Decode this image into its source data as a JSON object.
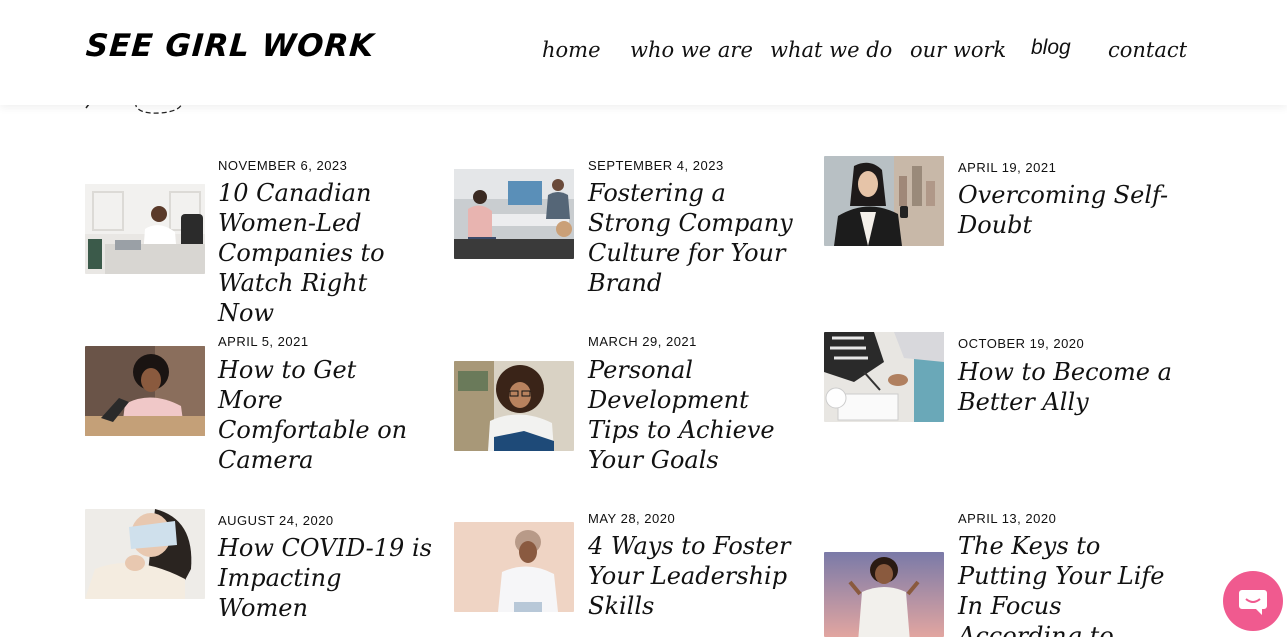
{
  "brand": {
    "logo_text": "SEE GIRL WORK"
  },
  "nav": {
    "items": [
      {
        "label": "home"
      },
      {
        "label": "who we are"
      },
      {
        "label": "what we do"
      },
      {
        "label": "our work"
      },
      {
        "label": "blog"
      },
      {
        "label": "contact"
      }
    ]
  },
  "posts": [
    {
      "date": "NOVEMBER 6, 2023",
      "title": "10 Canadian Women-Led Companies to Watch Right Now"
    },
    {
      "date": "SEPTEMBER 4, 2023",
      "title": "Fostering a Strong Company Culture for Your Brand"
    },
    {
      "date": "APRIL 19, 2021",
      "title": "Overcoming Self-Doubt"
    },
    {
      "date": "APRIL 5, 2021",
      "title": "How to Get More Comfortable on Camera"
    },
    {
      "date": "MARCH 29, 2021",
      "title": "Personal Development Tips to Achieve Your Goals"
    },
    {
      "date": "OCTOBER 19, 2020",
      "title": "How to Become a Better Ally"
    },
    {
      "date": "AUGUST 24, 2020",
      "title": "How COVID-19 is Impacting Women"
    },
    {
      "date": "MAY 28, 2020",
      "title": "4 Ways to Foster Your Leadership Skills"
    },
    {
      "date": "APRIL 13, 2020",
      "title": "The Keys to Putting Your Life In Focus According to"
    }
  ],
  "icons": {
    "chat": "chat-bubble-icon"
  },
  "colors": {
    "accent": "#f05a8f",
    "text": "#111111",
    "background": "#ffffff"
  }
}
